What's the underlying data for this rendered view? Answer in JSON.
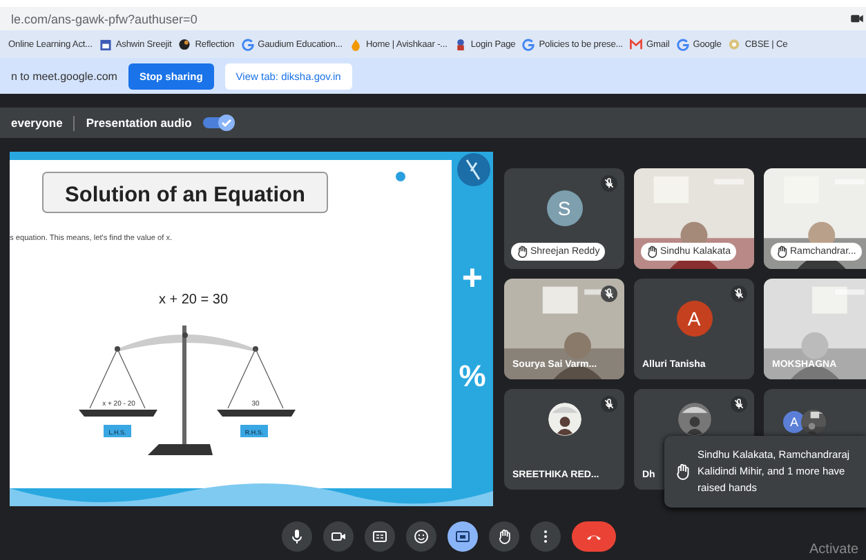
{
  "address_bar": {
    "url": "le.com/ans-gawk-pfw?authuser=0"
  },
  "bookmarks": [
    {
      "label": "Online Learning Act...",
      "kind": "none"
    },
    {
      "label": "Ashwin Sreejit",
      "kind": "calendar"
    },
    {
      "label": "Reflection",
      "kind": "dark"
    },
    {
      "label": "Gaudium Education...",
      "kind": "google"
    },
    {
      "label": "Home | Avishkaar -...",
      "kind": "flame"
    },
    {
      "label": "Login Page",
      "kind": "badge"
    },
    {
      "label": "Policies to be prese...",
      "kind": "google"
    },
    {
      "label": "Gmail",
      "kind": "gmail"
    },
    {
      "label": "Google",
      "kind": "google"
    },
    {
      "label": "CBSE | Ce",
      "kind": "emblem"
    }
  ],
  "sharing_bar": {
    "message": "n to meet.google.com",
    "buttons": [
      {
        "label": "Stop sharing",
        "kind": "primary"
      },
      {
        "label": "View tab: diksha.gov.in",
        "kind": "secondary"
      }
    ]
  },
  "presentation_bar": {
    "audience": "everyone",
    "audio_label": "Presentation audio",
    "audio_on": true
  },
  "slide": {
    "title": "Solution of an Equation",
    "text": "s equation. This means, let's find the value of x.",
    "equation": "x + 20 = 30",
    "left_pan": "x + 20 - 20",
    "right_pan": "30",
    "left_label": "L.H.S.",
    "right_label": "R.H.S.",
    "symbols": [
      "+",
      "%"
    ]
  },
  "participants": [
    {
      "name": "Shreejan Reddy",
      "kind": "avatar",
      "initial": "S",
      "color": "#7d9fae",
      "muted": true,
      "hand_raised": true
    },
    {
      "name": "Sindhu Kalakata",
      "kind": "video",
      "muted": false,
      "hand_raised": true
    },
    {
      "name": "Ramchandrar...",
      "kind": "video",
      "muted": false,
      "hand_raised": true
    },
    {
      "name": "Sourya Sai Varm...",
      "kind": "video",
      "muted": true,
      "hand_raised": false
    },
    {
      "name": "Alluri Tanisha",
      "kind": "avatar",
      "initial": "A",
      "color": "#c5401f",
      "muted": true,
      "hand_raised": false
    },
    {
      "name": "MOKSHAGNA",
      "kind": "video",
      "muted": false,
      "hand_raised": false
    },
    {
      "name": "SREETHIKA RED...",
      "muted": true,
      "hand_raised": false
    },
    {
      "name": "Dh",
      "muted": true,
      "hand_raised": false
    },
    {
      "kind": "pair",
      "initial": "A",
      "color": "#5b7fd6",
      "muted": false,
      "hand_raised": false
    }
  ],
  "notification": {
    "text": "Sindhu Kalakata, Ramchandraraj Kalidindi Mihir, and 1 more have raised hands"
  },
  "controls": [
    {
      "kind": "mic",
      "selected": false
    },
    {
      "kind": "camera",
      "selected": false
    },
    {
      "kind": "captions",
      "selected": false
    },
    {
      "kind": "emoji",
      "selected": false
    },
    {
      "kind": "present",
      "selected": true
    },
    {
      "kind": "hand",
      "selected": false
    },
    {
      "kind": "more",
      "selected": false
    },
    {
      "kind": "end",
      "selected": false
    }
  ],
  "os_notice": "Activate"
}
